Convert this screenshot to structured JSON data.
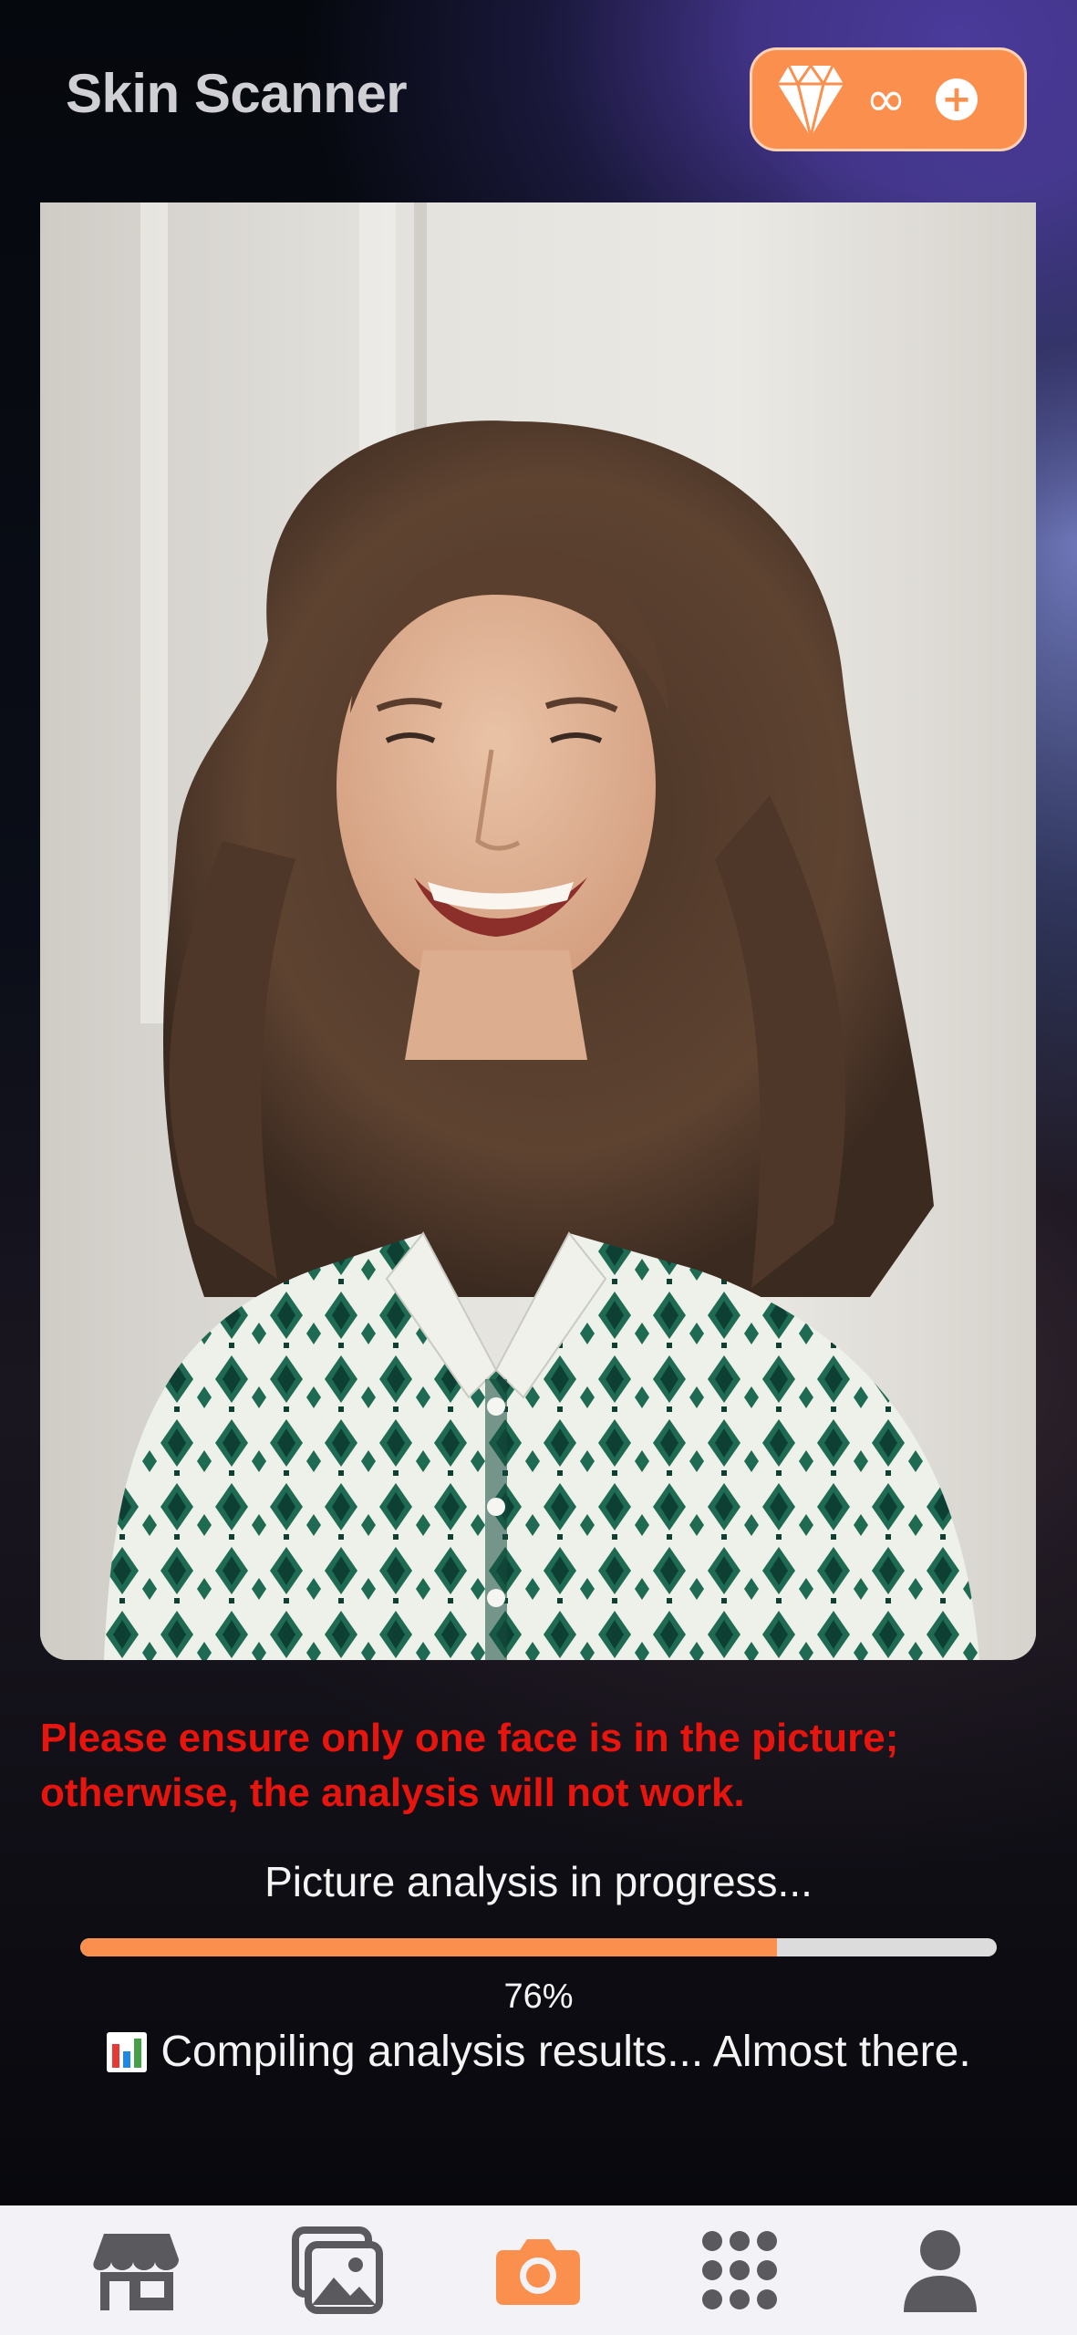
{
  "header": {
    "title": "Skin Scanner",
    "credits": {
      "icon": "diamond-icon",
      "value": "∞",
      "add_icon": "plus-circle-icon"
    }
  },
  "photo": {
    "icon": "user-photo"
  },
  "warning_text": "Please ensure only one face is in the picture; otherwise, the analysis will not work.",
  "analysis": {
    "label": "Picture analysis in progress...",
    "progress": 76,
    "progress_text": "76%",
    "status_icon": "bar-chart-icon",
    "status_text": "Compiling analysis results... Almost there."
  },
  "tabbar": {
    "items": [
      {
        "icon": "store-icon",
        "active": false
      },
      {
        "icon": "gallery-icon",
        "active": false
      },
      {
        "icon": "camera-icon",
        "active": true
      },
      {
        "icon": "grid-icon",
        "active": false
      },
      {
        "icon": "profile-icon",
        "active": false
      }
    ]
  },
  "colors": {
    "accent": "#fb8f4e",
    "warning": "#e8140e",
    "tab_inactive": "#5a5a5e",
    "tabbar_bg": "#f2f2f7"
  }
}
